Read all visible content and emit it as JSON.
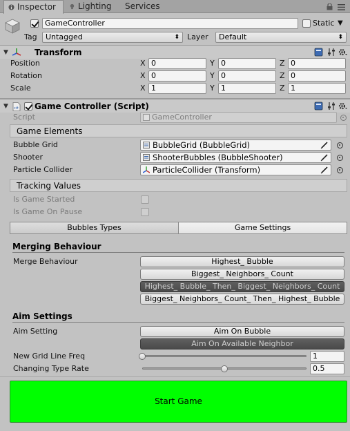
{
  "tabs": [
    {
      "label": "Inspector",
      "icon": "info-icon"
    },
    {
      "label": "Lighting",
      "icon": "lighting-icon"
    },
    {
      "label": "Services"
    }
  ],
  "window_controls": {
    "lock": "lock-icon",
    "menu": "menu-icon"
  },
  "gameobject": {
    "name": "GameController",
    "active": true,
    "static_label": "Static",
    "static_checked": false,
    "tag_label": "Tag",
    "tag_value": "Untagged",
    "layer_label": "Layer",
    "layer_value": "Default"
  },
  "transform": {
    "title": "Transform",
    "rows": [
      {
        "label": "Position",
        "x": "0",
        "y": "0",
        "z": "0"
      },
      {
        "label": "Rotation",
        "x": "0",
        "y": "0",
        "z": "0"
      },
      {
        "label": "Scale",
        "x": "1",
        "y": "1",
        "z": "1"
      }
    ],
    "axis": {
      "x": "X",
      "y": "Y",
      "z": "Z"
    }
  },
  "script_component": {
    "title": "Game Controller (Script)",
    "enabled": true,
    "script_label": "Script",
    "script_value": "GameController",
    "game_elements": {
      "title": "Game Elements",
      "rows": [
        {
          "label": "Bubble Grid",
          "value": "BubbleGrid (BubbleGrid)",
          "icon": "script-icon"
        },
        {
          "label": "Shooter",
          "value": "ShooterBubbles (BubbleShooter)",
          "icon": "script-icon"
        },
        {
          "label": "Particle Collider",
          "value": "ParticleCollider (Transform)",
          "icon": "transform-icon"
        }
      ]
    },
    "tracking": {
      "title": "Tracking Values",
      "rows": [
        {
          "label": "Is Game Started",
          "checked": false
        },
        {
          "label": "Is Game On Pause",
          "checked": false
        }
      ]
    },
    "toolbar": {
      "tabs": [
        {
          "label": "Bubbles Types",
          "selected": false
        },
        {
          "label": "Game Settings",
          "selected": true
        }
      ]
    },
    "merging": {
      "title": "Merging Behaviour",
      "label": "Merge Behaviour",
      "options": [
        {
          "label": "Highest_ Bubble",
          "selected": false
        },
        {
          "label": "Biggest_ Neighbors_ Count",
          "selected": false
        },
        {
          "label": "Highest_ Bubble_ Then_ Biggest_ Neighbors_ Count",
          "selected": true
        },
        {
          "label": "Biggest_ Neighbors_ Count_ Then_ Highest_ Bubble",
          "selected": false
        }
      ]
    },
    "aim": {
      "title": "Aim Settings",
      "label": "Aim Setting",
      "options": [
        {
          "label": "Aim On Bubble",
          "selected": false
        },
        {
          "label": "Aim On Available Neighbor",
          "selected": true
        }
      ],
      "sliders": [
        {
          "label": "New Grid Line Freq",
          "value": "1",
          "fraction": 0.0
        },
        {
          "label": "Changing Type Rate",
          "value": "0.5",
          "fraction": 0.5
        }
      ]
    },
    "start_button": "Start Game"
  },
  "colors": {
    "start_button": "#00ff00",
    "selected_option": "#4f4f4f",
    "panel_bg": "#c2c2c2"
  }
}
